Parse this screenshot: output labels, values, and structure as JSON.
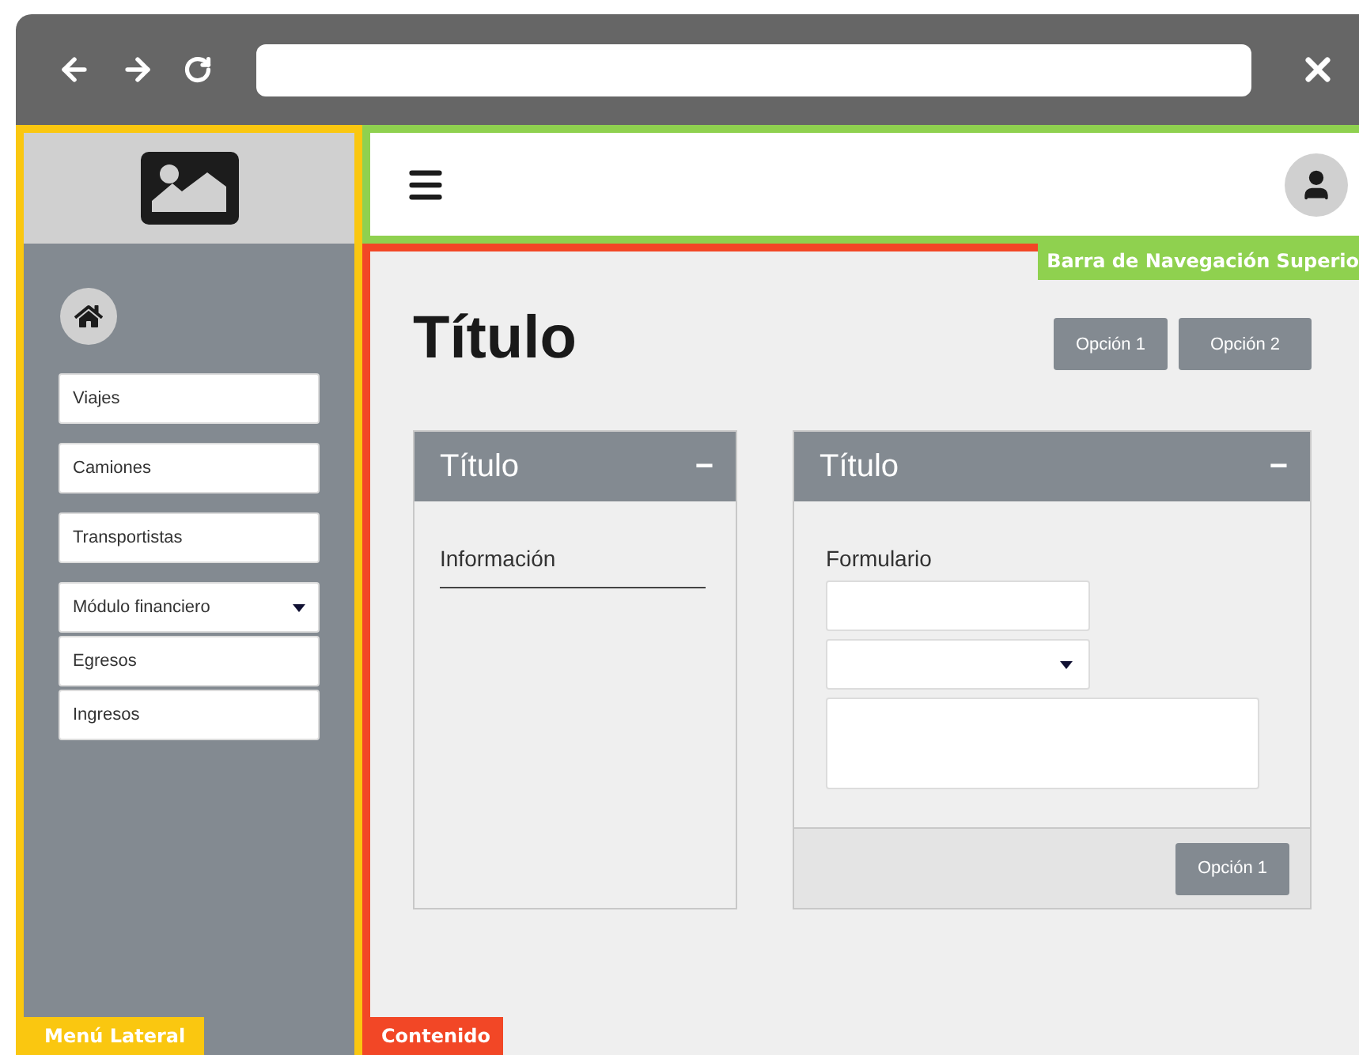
{
  "sidebar": {
    "items": [
      {
        "kind": "link",
        "label": "Viajes"
      },
      {
        "kind": "link",
        "label": "Camiones"
      },
      {
        "kind": "link",
        "label": "Transportistas"
      },
      {
        "kind": "dropdown",
        "label": "Módulo financiero",
        "expanded": true,
        "children": [
          {
            "label": "Egresos"
          },
          {
            "label": "Ingresos"
          }
        ]
      }
    ]
  },
  "content": {
    "title": "Título",
    "buttons": [
      "Opción 1",
      "Opción 2"
    ]
  },
  "panels": [
    {
      "kind": "info",
      "title": "Título",
      "collapse": "−",
      "label": "Información"
    },
    {
      "kind": "form",
      "title": "Título",
      "collapse": "−",
      "label": "Formulario",
      "footer_button": "Opción 1"
    }
  ],
  "annotations": [
    {
      "kind": "navbar",
      "label": "Barra de Navegación Superio",
      "color": "#8fd14f"
    },
    {
      "kind": "sidebar",
      "label": "Menú Lateral",
      "color": "#fac710"
    },
    {
      "kind": "content",
      "label": "Contenido",
      "color": "#f24726"
    }
  ]
}
